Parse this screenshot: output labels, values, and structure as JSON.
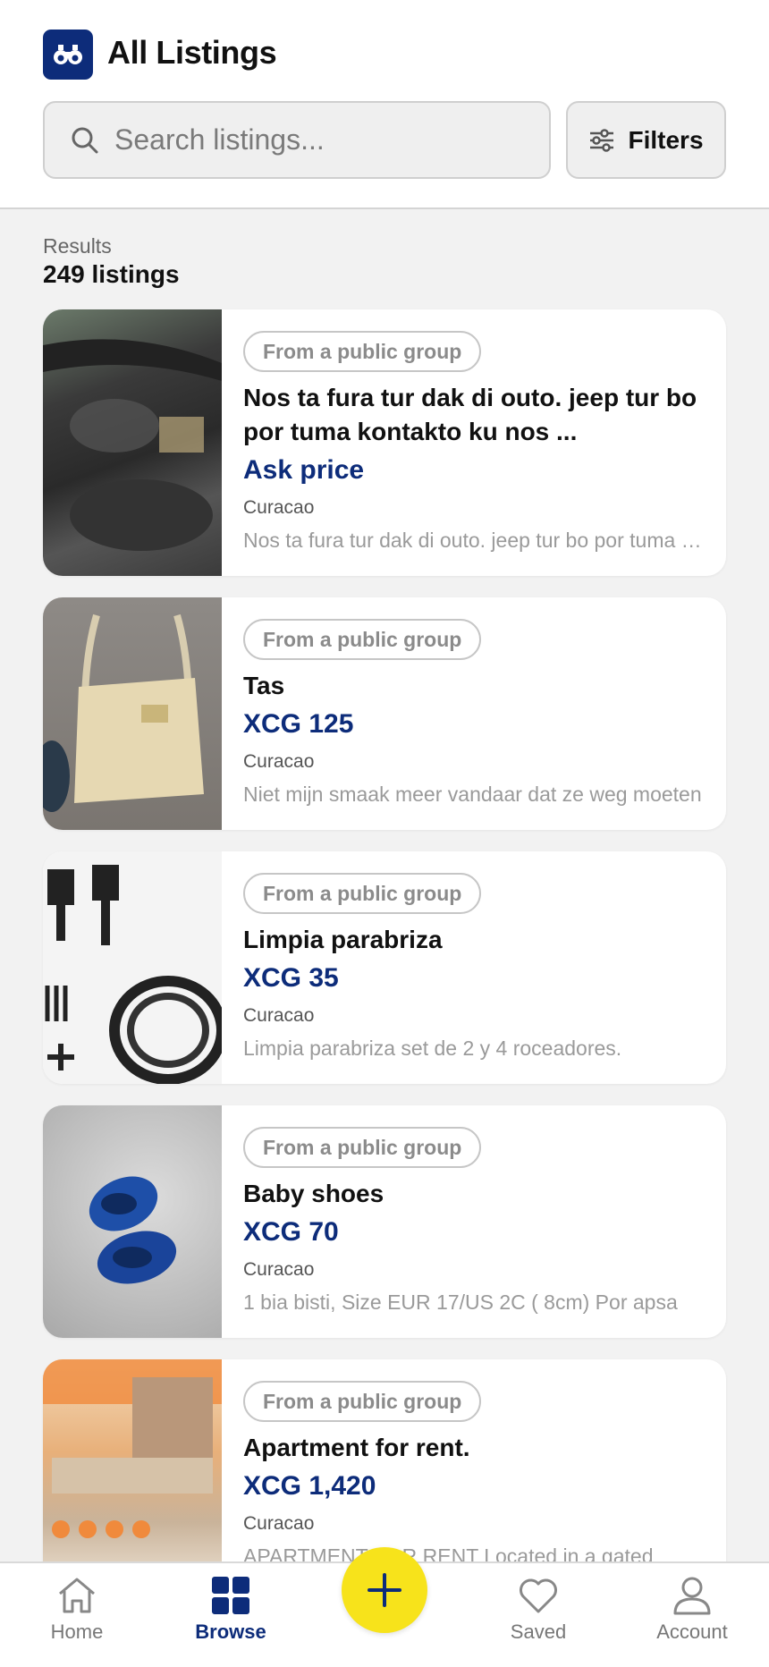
{
  "header": {
    "title": "All Listings",
    "logo_icon": "binoculars-icon",
    "search_placeholder": "Search listings...",
    "search_value": "",
    "filters_label": "Filters"
  },
  "results": {
    "label": "Results",
    "count": "249 listings"
  },
  "colors": {
    "brand_blue": "#0d2c7a",
    "fab_yellow": "#f7e31b"
  },
  "listings": [
    {
      "badge": "From a public group",
      "title": "Nos ta fura tur  dak di outo. jeep tur bo por tuma kontakto ku nos  ...",
      "price": "Ask price",
      "location": "Curacao",
      "description": "Nos ta fura tur dak di outo. jeep tur bo por tuma kontakto ku nos"
    },
    {
      "badge": "From a public group",
      "title": "Tas",
      "price": "XCG 125",
      "location": "Curacao",
      "description": "Niet mijn smaak meer vandaar dat ze weg moeten"
    },
    {
      "badge": "From a public group",
      "title": "Limpia parabriza",
      "price": "XCG 35",
      "location": "Curacao",
      "description": "Limpia parabriza set de 2 y 4 roceadores."
    },
    {
      "badge": "From a public group",
      "title": "Baby shoes",
      "price": "XCG 70",
      "location": "Curacao",
      "description": "1 bia bisti, Size EUR 17/US 2C ( 8cm) Por apsa"
    },
    {
      "badge": "From a public group",
      "title": "Apartment for rent.",
      "price": "XCG 1,420",
      "location": "Curacao",
      "description": "APARTMENT FOR RENT Located in a gated"
    }
  ],
  "nav": {
    "home": "Home",
    "browse": "Browse",
    "saved": "Saved",
    "account": "Account",
    "add_icon": "plus-icon"
  }
}
